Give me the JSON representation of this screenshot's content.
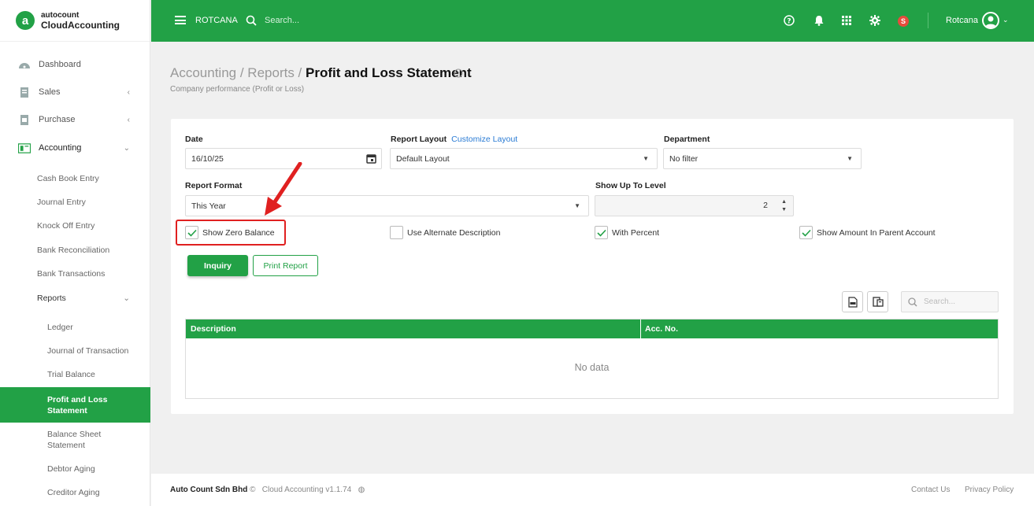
{
  "brand": {
    "top": "autocount",
    "bottom": "CloudAccounting",
    "mark": "a"
  },
  "topbar": {
    "company": "ROTCANA",
    "search_placeholder": "Search...",
    "badge": "S",
    "user": "Rotcana"
  },
  "sidebar": {
    "items": [
      {
        "label": "Dashboard",
        "icon": "dashboard-icon"
      },
      {
        "label": "Sales",
        "icon": "sales-icon"
      },
      {
        "label": "Purchase",
        "icon": "purchase-icon"
      },
      {
        "label": "Accounting",
        "icon": "accounting-icon"
      }
    ],
    "accounting_sub": [
      "Cash Book Entry",
      "Journal Entry",
      "Knock Off Entry",
      "Bank Reconciliation",
      "Bank Transactions",
      "Reports"
    ],
    "reports_sub": [
      "Ledger",
      "Journal of Transaction",
      "Trial Balance",
      "Profit and Loss Statement",
      "Balance Sheet Statement",
      "Debtor Aging",
      "Creditor Aging"
    ]
  },
  "page": {
    "crumb1": "Accounting",
    "crumb2": "Reports",
    "title": "Profit and Loss Statement",
    "subtitle": "Company performance (Profit or Loss)"
  },
  "form": {
    "date_label": "Date",
    "date_value": "16/10/25",
    "layout_label": "Report Layout",
    "layout_link": "Customize Layout",
    "layout_value": "Default Layout",
    "dept_label": "Department",
    "dept_value": "No filter",
    "format_label": "Report Format",
    "format_value": "This Year",
    "level_label": "Show Up To Level",
    "level_value": "2",
    "chk_zero": "Show Zero Balance",
    "chk_alt": "Use Alternate Description",
    "chk_percent": "With Percent",
    "chk_parent": "Show Amount In Parent Account",
    "inquiry": "Inquiry",
    "print": "Print Report",
    "search_placeholder": "Search..."
  },
  "table": {
    "col1": "Description",
    "col2": "Acc. No.",
    "empty": "No data"
  },
  "footer": {
    "company": "Auto Count Sdn Bhd",
    "version": "Cloud Accounting v1.1.74",
    "contact": "Contact Us",
    "privacy": "Privacy Policy"
  },
  "colors": {
    "primary": "#22a146",
    "highlight": "#e02020",
    "link": "#2a7bd4"
  }
}
